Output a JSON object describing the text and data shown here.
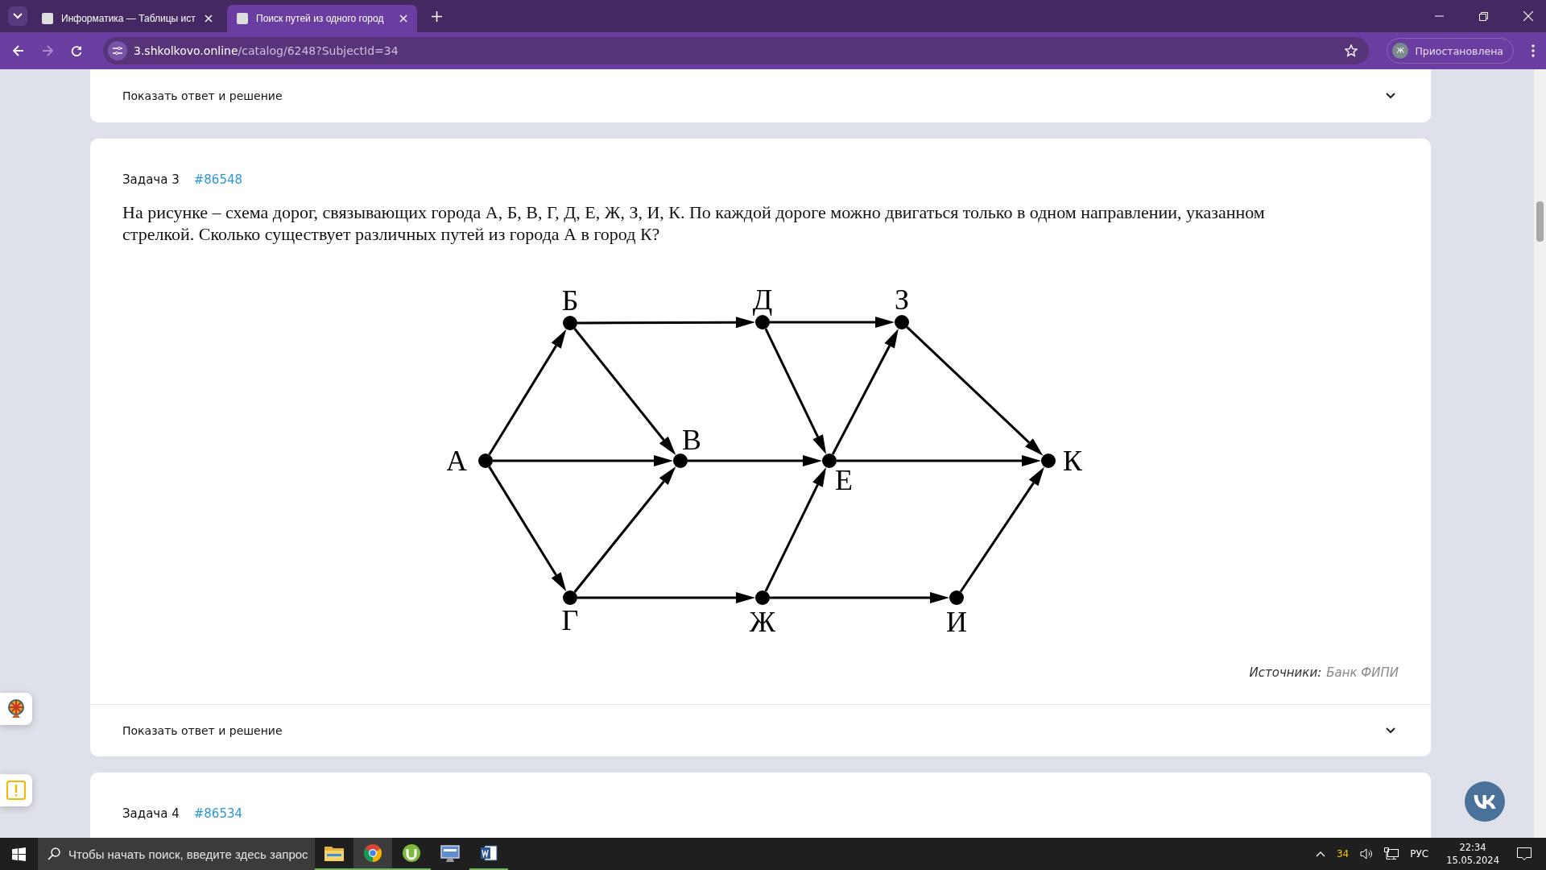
{
  "browser": {
    "tabs": [
      {
        "title": "Информатика — Таблицы ист",
        "selected": false
      },
      {
        "title": "Поиск путей из одного город",
        "selected": true
      }
    ],
    "url_host": "3.shkolkovo.online",
    "url_path": "/catalog/6248?SubjectId=34",
    "profile": {
      "initial": "Ж",
      "status": "Приостановлена"
    }
  },
  "previous_task": {
    "toggle": "Показать ответ и решение"
  },
  "task": {
    "title": "Задача 3",
    "number": "#86548",
    "question": "На рисунке – схема дорог, связывающих города А, Б, В, Г, Д, Е, Ж, З, И, К. По каждой дороге можно двигаться только в одном направлении, указанном стрелкой. Сколько существует различных путей из города А в город К?",
    "graph_nodes": [
      {
        "label": "А"
      },
      {
        "label": "Б"
      },
      {
        "label": "В"
      },
      {
        "label": "Г"
      },
      {
        "label": "Д"
      },
      {
        "label": "Е"
      },
      {
        "label": "Ж"
      },
      {
        "label": "З"
      },
      {
        "label": "И"
      },
      {
        "label": "К"
      }
    ],
    "sources_label": "Источники:",
    "source": "Банк ФИПИ",
    "toggle": "Показать ответ и решение"
  },
  "next_task": {
    "title": "Задача 4",
    "number": "#86534"
  },
  "taskbar": {
    "search_placeholder": "Чтобы начать поиск, введите здесь запрос",
    "temperature": "34",
    "language": "РУС",
    "time": "22:34",
    "date": "15.05.2024"
  }
}
